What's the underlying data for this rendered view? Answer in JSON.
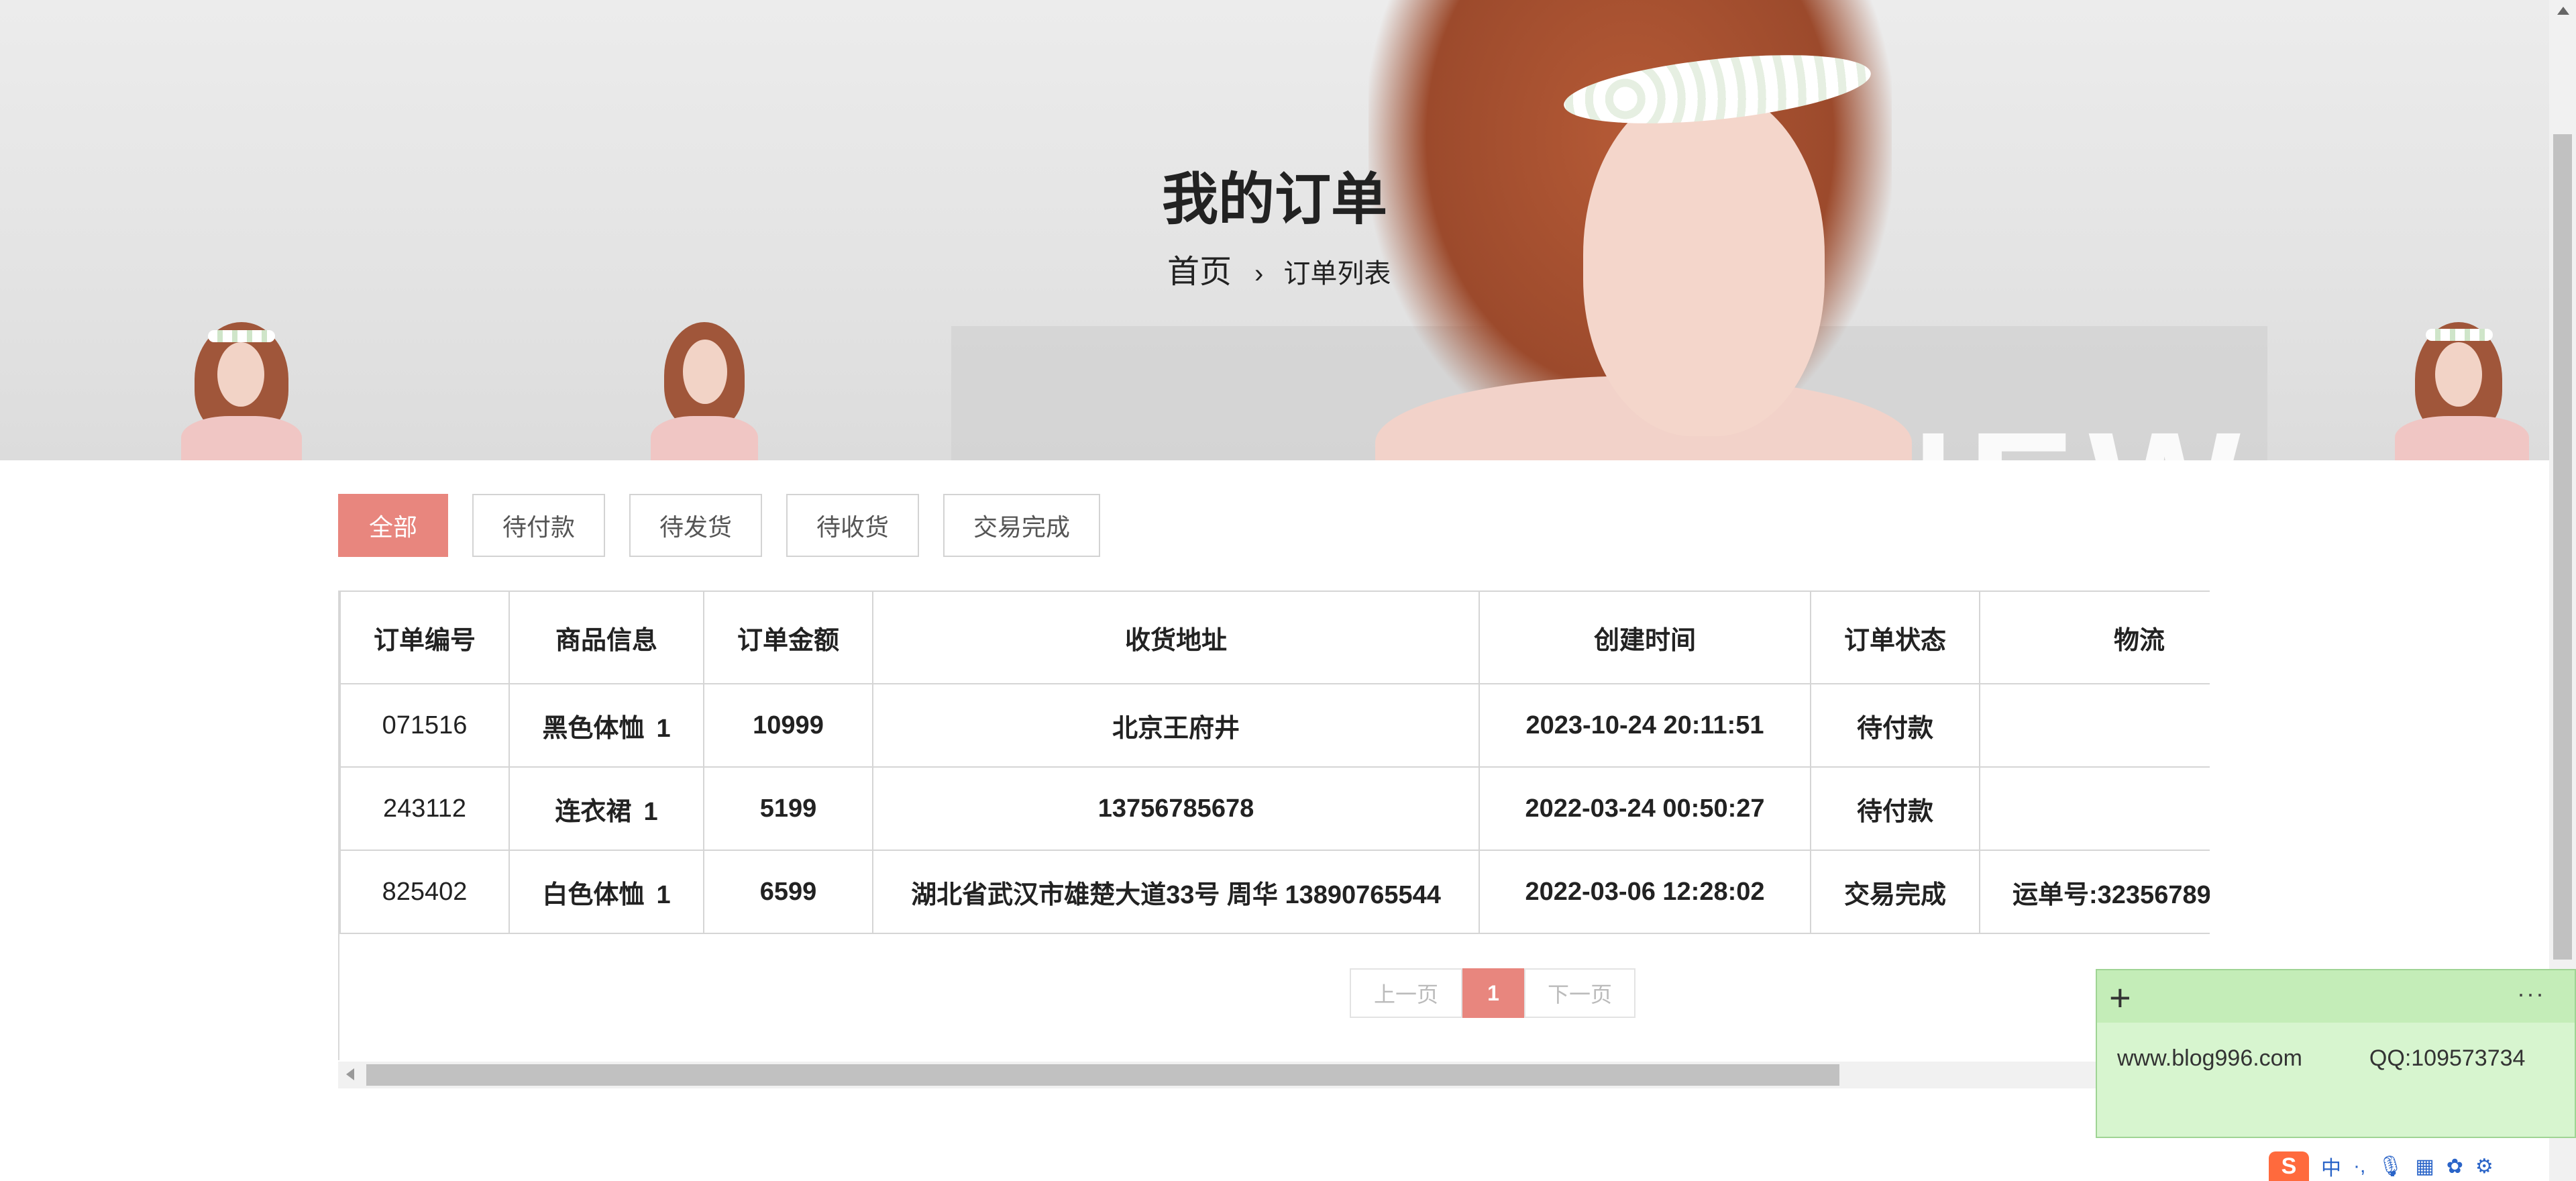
{
  "hero": {
    "title": "我的订单",
    "breadcrumb": {
      "home": "首页",
      "separator": "›",
      "current": "订单列表"
    },
    "decor_text": "NEW"
  },
  "tabs": [
    {
      "label": "全部",
      "active": true
    },
    {
      "label": "待付款",
      "active": false
    },
    {
      "label": "待发货",
      "active": false
    },
    {
      "label": "待收货",
      "active": false
    },
    {
      "label": "交易完成",
      "active": false
    }
  ],
  "table": {
    "headers": [
      "订单编号",
      "商品信息",
      "订单金额",
      "收货地址",
      "创建时间",
      "订单状态",
      "物流"
    ],
    "rows": [
      {
        "id": "071516",
        "product": "黑色体恤",
        "qty": "1",
        "amount": "10999",
        "address": "北京王府井",
        "created": "2023-10-24 20:11:51",
        "status": "待付款",
        "logistics": ""
      },
      {
        "id": "243112",
        "product": "连衣裙",
        "qty": "1",
        "amount": "5199",
        "address": "13756785678",
        "created": "2022-03-24 00:50:27",
        "status": "待付款",
        "logistics": ""
      },
      {
        "id": "825402",
        "product": "白色体恤",
        "qty": "1",
        "amount": "6599",
        "address": "湖北省武汉市雄楚大道33号 周华 13890765544",
        "created": "2022-03-06 12:28:02",
        "status": "交易完成",
        "logistics": "运单号:32356789"
      }
    ]
  },
  "pagination": {
    "prev": "上一页",
    "current": "1",
    "next": "下一页"
  },
  "note": {
    "site": "www.blog996.com",
    "qq": "QQ:109573734",
    "more": "···",
    "add": "+"
  },
  "ime": {
    "logo": "S",
    "lang": "中"
  },
  "colors": {
    "accent": "#e8867e",
    "note_bg": "#d7f5cf"
  }
}
